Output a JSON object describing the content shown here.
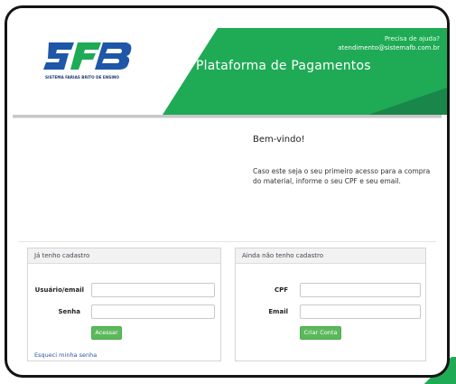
{
  "header": {
    "brand_title": "Plataforma de Pagamentos",
    "logo_tagline": "SISTEMA FARIAS BRITO DE ENSINO",
    "help_question": "Precisa de ajuda?",
    "help_email": "atendimento@sistemafb.com.br"
  },
  "welcome": {
    "title": "Bem-vindo!",
    "text": "Caso este seja o seu primeiro acesso para a compra do material, informe o seu CPF e seu email."
  },
  "login": {
    "heading": "Já tenho cadastro",
    "username_label": "Usuário/email",
    "password_label": "Senha",
    "username_value": "",
    "password_value": "",
    "submit_label": "Acessar",
    "forgot_label": "Esqueci minha senha"
  },
  "register": {
    "heading": "Ainda não tenho cadastro",
    "cpf_label": "CPF",
    "email_label": "Email",
    "cpf_value": "",
    "email_value": "",
    "submit_label": "Criar Conta"
  },
  "colors": {
    "brand_blue": "#1e56a8",
    "brand_green": "#1faa55",
    "button_green": "#5cb85c"
  }
}
